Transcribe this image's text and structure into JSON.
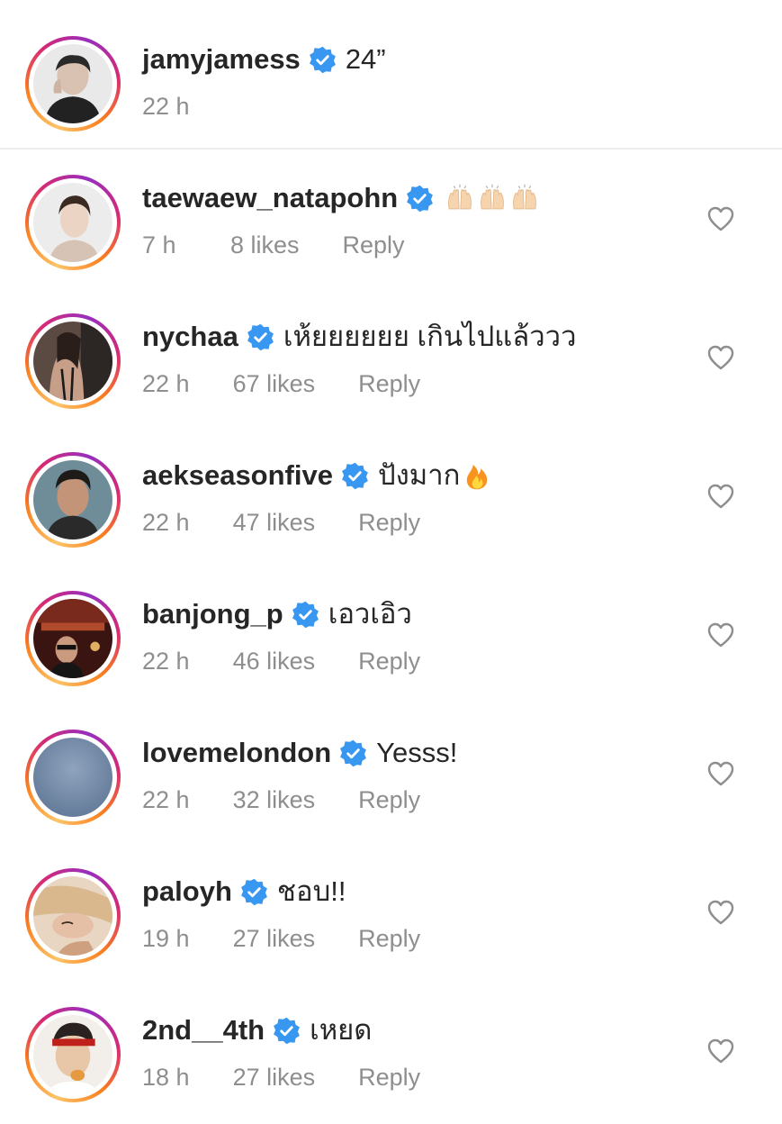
{
  "caption": {
    "username": "jamyjamess",
    "text": "24”",
    "time": "22 h"
  },
  "comments": [
    {
      "username": "taewaew_natapohn",
      "text": "",
      "emoji": "raised-hands x3",
      "time": "7 h",
      "likes": "8 likes",
      "reply": "Reply"
    },
    {
      "username": "nychaa",
      "text": "เห้ยยยยยย เกินไปแล้ววว",
      "time": "22 h",
      "likes": "67 likes",
      "reply": "Reply"
    },
    {
      "username": "aekseasonfive",
      "text": "ปังมาก",
      "emoji": "fire",
      "time": "22 h",
      "likes": "47 likes",
      "reply": "Reply"
    },
    {
      "username": "banjong_p",
      "text": "เอวเอิว",
      "time": "22 h",
      "likes": "46 likes",
      "reply": "Reply"
    },
    {
      "username": "lovemelondon",
      "text": "Yesss!",
      "time": "22 h",
      "likes": "32 likes",
      "reply": "Reply"
    },
    {
      "username": "paloyh",
      "text": "ชอบ!!",
      "time": "19 h",
      "likes": "27 likes",
      "reply": "Reply"
    },
    {
      "username": "2nd__4th",
      "text": "เหยด",
      "time": "18 h",
      "likes": "27 likes",
      "reply": "Reply"
    }
  ],
  "colors": {
    "verified": "#3897f0",
    "text": "#262626",
    "meta": "#8e8e8e",
    "divider": "#ededed"
  }
}
